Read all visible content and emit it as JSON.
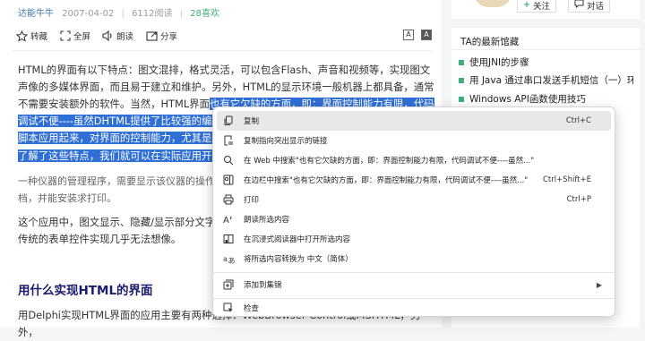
{
  "meta": {
    "author": "达能牛牛",
    "date": "2007-04-02",
    "reads": "6112阅读",
    "likes": "28喜欢"
  },
  "toolbar": {
    "favorite": "转藏",
    "fullscreen": "全屏",
    "read_aloud": "朗读",
    "share": "分享",
    "font_a": "A",
    "font_a_inv": "A"
  },
  "article": {
    "p1_before": "HTML的界面有以下特点：图文混排，格式灵活，可以包含Flash、声音和视频等，实现图文声像的多媒体界面，而且易于建立和维护。另外，HTML的显示环境一般机器上都具备，通常不需要安装额外的软件。当然，HTML界面",
    "p1_selected": "也有它欠缺的方面，即：界面控制能力有限，代码调试不便----虽然DHTML提供了比较强的编程能力，但它的调试非常不方便，尤其是复杂的脚本应用起来，对界面的控制能力，尤其是和数据交互的能力还是比较欠缺。",
    "p2_selected": "了解了这些特点，我们就可以在实际应用开发中扬长避短。",
    "p3": "一种仪器的管理程序，需要显示该仪器的操作界面，包括仪器示意图、检测进度，以及显示文档，并能安装求打印。",
    "p4": "这个应用中，图文显示、隐藏/显示部分文字等动态效果，HTML都可以很方便地实现，而用传统的表单控件实现几乎无法想像。",
    "h2": "用什么实现HTML的界面",
    "p5": "用Delphi实现HTML界面的应用主要有两种选择：WebBrowser Control或MSHTML，另外，"
  },
  "profile": {
    "follow": "关注",
    "follow_plus": "+",
    "chat": "对话"
  },
  "sidebar": {
    "title": "TA的最新馆藏",
    "items": [
      {
        "label": "使用JNI的步骤"
      },
      {
        "label": "用 Java 通过串口发送手机短信（一）环..."
      },
      {
        "label": "Windows API函数使用技巧"
      }
    ]
  },
  "context_menu": {
    "items": [
      {
        "icon": "copy-icon",
        "label": "复制",
        "shortcut": "Ctrl+C"
      },
      {
        "icon": "link-highlight-icon",
        "label": "复制指向突出显示的链接",
        "shortcut": ""
      },
      {
        "icon": "search-icon",
        "label": "在 Web 中搜索\"也有它欠缺的方面，即：界面控制能力有限，代码调试不便----虽然...\"",
        "shortcut": ""
      },
      {
        "icon": "sidebar-search-icon",
        "label": "在边栏中搜索\"也有它欠缺的方面，即：界面控制能力有限，代码调试不便----虽然...\"",
        "shortcut": "Ctrl+Shift+E"
      },
      {
        "icon": "printer-icon",
        "label": "打印",
        "shortcut": "Ctrl+P"
      },
      {
        "icon": "read-aloud-icon",
        "label": "朗读所选内容",
        "shortcut": ""
      },
      {
        "icon": "immersive-reader-icon",
        "label": "在沉浸式阅读器中打开所选内容",
        "shortcut": ""
      },
      {
        "icon": "translate-icon",
        "label": "将所选内容转换为 中文（简体）",
        "shortcut": ""
      },
      {
        "icon": "collections-icon",
        "label": "添加到集锦",
        "shortcut": ""
      },
      {
        "icon": "inspect-icon",
        "label": "检查",
        "shortcut": ""
      }
    ]
  }
}
